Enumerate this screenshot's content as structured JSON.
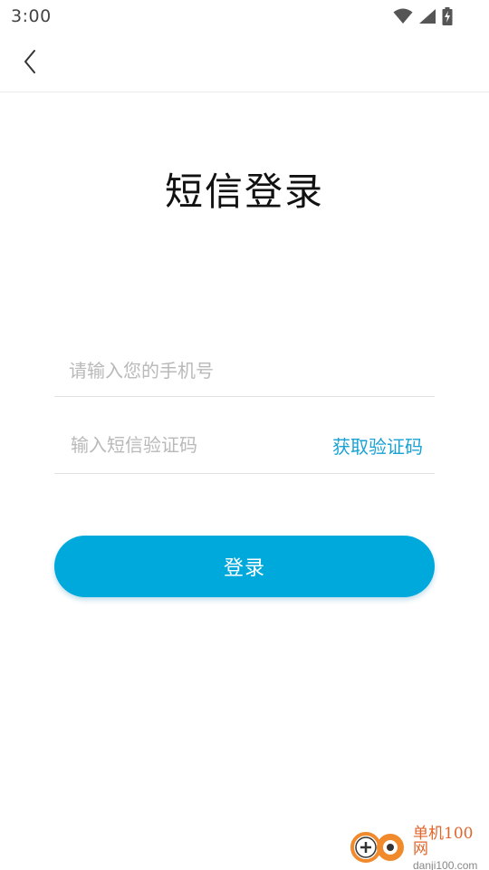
{
  "status_bar": {
    "time": "3:00",
    "icons": [
      "wifi-icon",
      "signal-icon",
      "battery-charging-icon"
    ]
  },
  "app_bar": {
    "back_icon": "chevron-left-icon"
  },
  "page": {
    "title": "短信登录"
  },
  "form": {
    "phone_placeholder": "请输入您的手机号",
    "phone_value": "",
    "code_placeholder": "输入短信验证码",
    "code_value": "",
    "get_code_label": "获取验证码",
    "login_label": "登录"
  },
  "watermark": {
    "title": "单机100网",
    "url": "danji100.com"
  },
  "colors": {
    "accent": "#00a9dc",
    "link": "#1aa2d4",
    "placeholder": "#b9b9b9",
    "divider": "#e2e2e2"
  }
}
